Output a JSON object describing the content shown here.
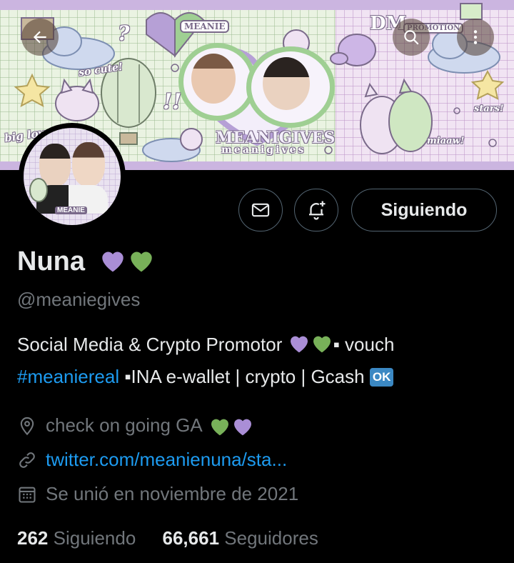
{
  "banner": {
    "labels": {
      "so_cute": "so cute!",
      "meanie": "MEANIE",
      "dm_for": "DM",
      "promotion": "PROMOTION",
      "stars": "stars!",
      "big_love": "big love",
      "miaaw": "miaaw!",
      "meanigives_big": "MEANIGIVES",
      "meanigives_small": "meanigives",
      "exclaim": "!!",
      "question": "?"
    },
    "colors": {
      "lavender": "#cbb5e0",
      "green_grid": "#eaf3e2",
      "pink_grid": "#f1e4f3"
    }
  },
  "nav": {
    "back_icon": "arrow-left-icon",
    "search_icon": "search-icon",
    "more_icon": "more-vertical-icon"
  },
  "avatar": {
    "label": "MEANIE"
  },
  "actions": {
    "message_icon": "envelope-icon",
    "notify_icon": "bell-plus-icon",
    "follow_label": "Siguiendo"
  },
  "profile": {
    "name": "Nuna",
    "handle": "@meaniegives",
    "bio_line1": "Social Media & Crypto Promotor",
    "bio_line1_suffix": "▪ vouch",
    "bio_hashtag": "#meaniereal",
    "bio_line2_rest": " ▪INA e-wallet | crypto | Gcash",
    "ok_badge": "OK",
    "location": "check on going GA",
    "link": "twitter.com/meanienuna/sta...",
    "joined": "Se unió en noviembre de 2021"
  },
  "stats": {
    "following_count": "262",
    "following_label": "Siguiendo",
    "followers_count": "66,661",
    "followers_label": "Seguidores"
  },
  "colors": {
    "accent": "#1d9bf0",
    "purple_heart": "#aa8ed6",
    "green_heart": "#78b159",
    "muted": "#71767b"
  }
}
